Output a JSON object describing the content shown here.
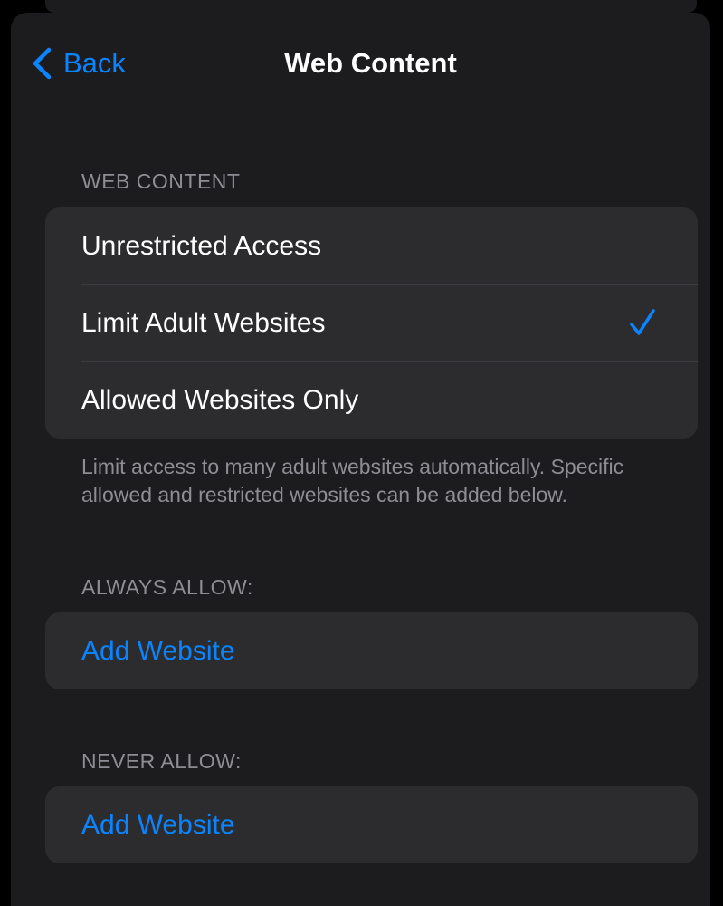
{
  "nav": {
    "back_label": "Back",
    "title": "Web Content"
  },
  "web_content": {
    "header": "WEB CONTENT",
    "options": [
      {
        "label": "Unrestricted Access",
        "selected": false
      },
      {
        "label": "Limit Adult Websites",
        "selected": true
      },
      {
        "label": "Allowed Websites Only",
        "selected": false
      }
    ],
    "footer": "Limit access to many adult websites automatically. Specific allowed and restricted websites can be added below."
  },
  "always_allow": {
    "header": "ALWAYS ALLOW:",
    "add_label": "Add Website"
  },
  "never_allow": {
    "header": "NEVER ALLOW:",
    "add_label": "Add Website"
  },
  "icons": {
    "back": "chevron-left-icon",
    "selected": "checkmark-icon"
  },
  "colors": {
    "accent": "#0a84ff",
    "background": "#1c1c1e",
    "cell": "#2c2c2e",
    "secondary_text": "#8d8d93",
    "separator": "#3d3d41"
  }
}
